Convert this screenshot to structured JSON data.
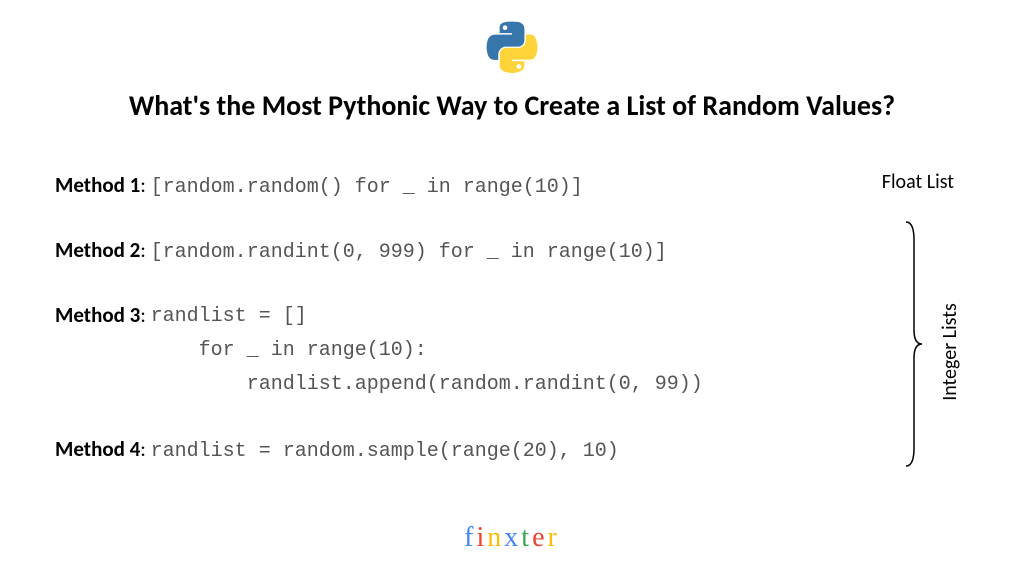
{
  "title": "What's the Most Pythonic Way to Create a List of Random Values?",
  "methods": [
    {
      "label": "Method 1",
      "code": "[random.random() for _ in range(10)]"
    },
    {
      "label": "Method 2",
      "code": "[random.randint(0, 999) for _ in range(10)]"
    },
    {
      "label": "Method 3",
      "code": "randlist = []\n    for _ in range(10):\n        randlist.append(random.randint(0, 99))"
    },
    {
      "label": "Method 4",
      "code": "randlist = random.sample(range(20), 10)"
    }
  ],
  "annotations": {
    "float": "Float List",
    "integer": "Integer Lists"
  },
  "brand": {
    "f": "f",
    "i": "i",
    "n": "n",
    "x": "x",
    "t": "t",
    "e": "e",
    "r": "r"
  }
}
